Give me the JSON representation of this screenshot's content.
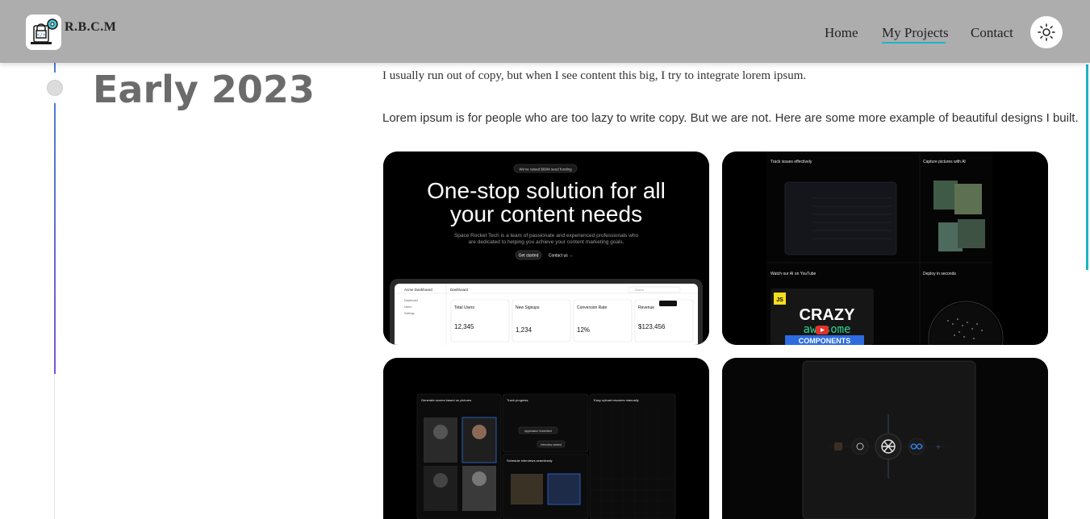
{
  "brand": {
    "name": "R.B.C.M",
    "logo_icon": "laptop-lock-gear-icon"
  },
  "nav": {
    "items": [
      {
        "label": "Home"
      },
      {
        "label": "My Projects",
        "active": true
      },
      {
        "label": "Contact"
      }
    ],
    "theme_toggle_icon": "sun-icon",
    "accent": "#1ab5c4"
  },
  "timeline": {
    "period": "Early 2023"
  },
  "content": {
    "intro": "I usually run out of copy, but when I see content this big, I try to integrate lorem ipsum.",
    "body": "Lorem ipsum is for people who are too lazy to write copy. But we are not. Here are some more example of beautiful designs I built."
  },
  "cards": [
    {
      "pill": "We've raised $69M seed funding",
      "headline_1": "One-stop solution for all",
      "headline_2": "your content needs",
      "sub_1": "Space Rocket Tech is a team of passionate and experienced professionals who",
      "sub_2": "are dedicated to helping you achieve your content marketing goals.",
      "cta_primary": "Get started",
      "cta_secondary": "Contact us →",
      "dashboard": {
        "app": "Acme Dashboard",
        "title": "Dashboard",
        "search": "Search",
        "sidebar": [
          "Dashboard",
          "Users",
          "Settings"
        ],
        "stats": [
          {
            "label": "Total Users",
            "value": "12,345"
          },
          {
            "label": "New Signups",
            "value": "1,234"
          },
          {
            "label": "Conversion Rate",
            "value": "12%"
          },
          {
            "label": "Revenue",
            "value": "$123,456"
          }
        ]
      }
    },
    {
      "sections": [
        "Track issues effectively",
        "Capture pictures with AI",
        "Watch our AI on YouTube",
        "Deploy in seconds"
      ],
      "thumb_badge": "JS",
      "thumb_line1": "CRAZY",
      "thumb_line2": "awesome",
      "thumb_line3": "COMPONENTS"
    },
    {
      "sections": [
        "Generate scores based on pictures",
        "Track progress",
        "Easy upload resumes manually",
        "Schedule interviews seamlessly"
      ],
      "tags": [
        "Application Submitted",
        "Interview started"
      ]
    },
    {
      "icons": [
        "openai-icon",
        "meta-icon"
      ]
    }
  ]
}
